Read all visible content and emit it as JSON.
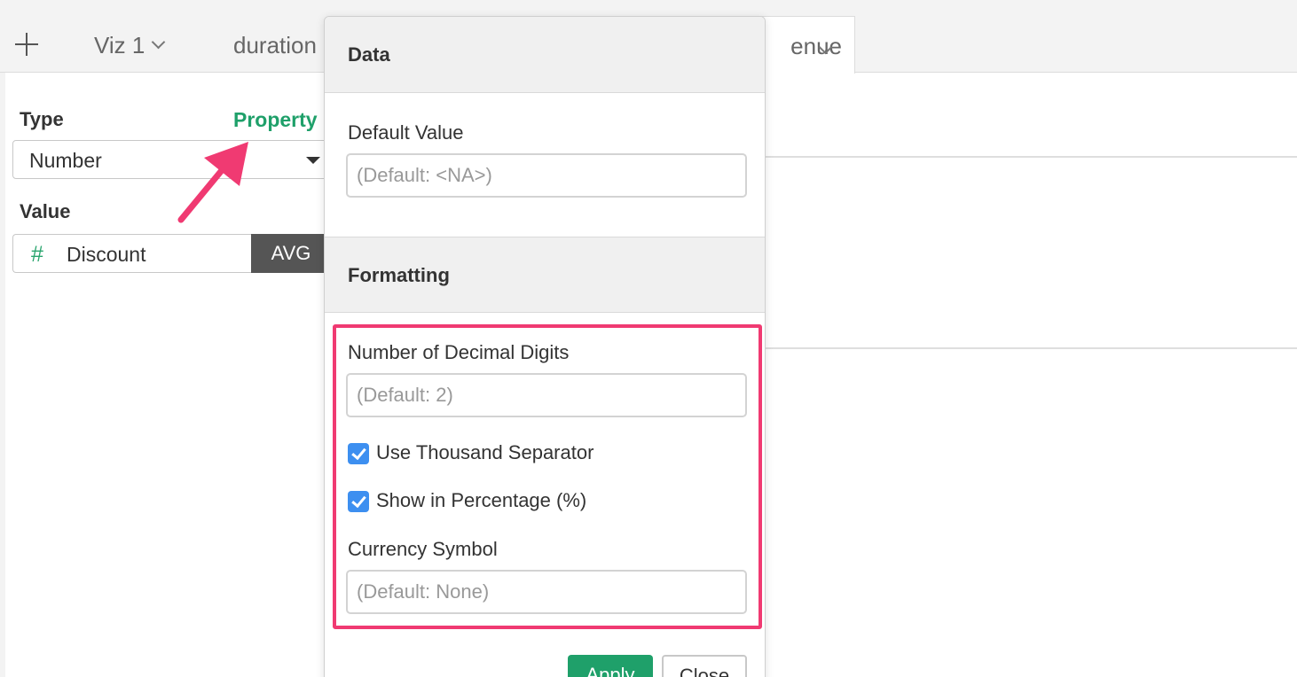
{
  "tabs": [
    {
      "label": "Viz 1"
    },
    {
      "label": "duration"
    },
    {
      "label": "enue"
    }
  ],
  "left_panel": {
    "type_label": "Type",
    "property_link": "Property",
    "type_value": "Number",
    "value_label": "Value",
    "value_field": "Discount",
    "aggregate": "AVG"
  },
  "popover": {
    "data_header": "Data",
    "default_value_label": "Default Value",
    "default_value_placeholder": "(Default: <NA>)",
    "formatting_header": "Formatting",
    "decimal_label": "Number of Decimal Digits",
    "decimal_placeholder": "(Default: 2)",
    "thousand_separator_label": "Use Thousand Separator",
    "thousand_separator_checked": true,
    "percentage_label": "Show in Percentage (%)",
    "percentage_checked": true,
    "currency_label": "Currency Symbol",
    "currency_placeholder": "(Default: None)",
    "apply_label": "Apply",
    "close_label": "Close"
  },
  "colors": {
    "accent_green": "#1fa06a",
    "highlight_pink": "#f03a72",
    "checkbox_blue": "#3d8ff0"
  }
}
